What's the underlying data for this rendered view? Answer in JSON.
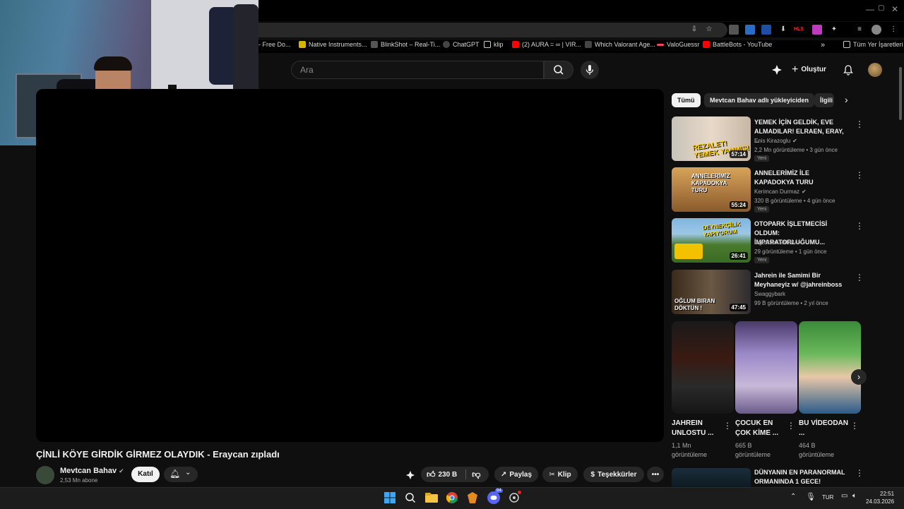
{
  "browser": {
    "bookmarks": [
      {
        "label": "- Free Do...",
        "color": "#000000"
      },
      {
        "label": "Native Instruments...",
        "color": "#d9b200"
      },
      {
        "label": "BlinkShot – Real-Ti...",
        "color": "#555555"
      },
      {
        "label": "ChatGPT",
        "color": "#444444"
      },
      {
        "label": "klip",
        "color": "#000000"
      },
      {
        "label": "(2) AURA = ∞ | VIR...",
        "color": "#ff0000"
      },
      {
        "label": "Which Valorant Age...",
        "color": "#444444"
      },
      {
        "label": "ValoGuessr",
        "color": "#ff4655"
      },
      {
        "label": "BattleBots - YouTube",
        "color": "#ff0000"
      }
    ],
    "all_bookmarks": "Tüm Yer İşaretleri",
    "more_bookmarks": "»"
  },
  "youtube": {
    "search_placeholder": "Ara",
    "create_label": "Oluştur",
    "video": {
      "title": "ÇİNLİ KÖYE GİRDİK GİRMEZ OLAYDIK - Eraycan zıpladı",
      "channel": "Mevtcan Bahav",
      "subscribers": "2,53 Mn abone",
      "join": "Katıl",
      "likes": "230 B",
      "share": "Paylaş",
      "clip": "Klip",
      "thanks": "Teşekkürler"
    },
    "chips": [
      "Tümü",
      "Mevtcan Bahav adlı yükleyiciden",
      "İlgili"
    ],
    "recommendations": [
      {
        "title": "YEMEK İÇİN GELDİK, EVE ALMADILAR! ELRAEN, ERAY, ...",
        "channel": "Enis Kirazoglu",
        "verified": true,
        "meta": "2,2 Mn görüntüleme • 3 gün önce",
        "badge": "Yeni",
        "duration": "57:14",
        "thumb_text": "REZALET! YEMEK YANMIŞ!"
      },
      {
        "title": "ANNELERİMİZ İLE KAPADOKYA TURU",
        "channel": "Kerimcan Durmaz",
        "verified": true,
        "meta": "320 B görüntüleme • 4 gün önce",
        "badge": "Yeni",
        "duration": "55:24",
        "thumb_text": "ANNELERİMİZ KAPADOKYA TURU"
      },
      {
        "title": "OTOPARK İŞLETMECİSİ OLDUM: İMPARATORLUĞUMU...",
        "channel": "Oğuzhan SALMAN",
        "verified": false,
        "meta": "29 görüntüleme • 1 gün önce",
        "badge": "Yeni",
        "duration": "26:41",
        "thumb_text": "DEYNEKÇİLİK YAPIYORUM"
      },
      {
        "title": "Jahrein ile Samimi Bir Meyhaneyiz w/ @jahreinboss",
        "channel": "Swaggybark",
        "verified": false,
        "meta": "99 B görüntüleme • 2 yıl önce",
        "badge": "",
        "duration": "47:45",
        "thumb_text": "OĞLUM BIRAN DÖKTÜN !"
      }
    ],
    "shorts": [
      {
        "title": "JAHREIN UNLOSTU ...",
        "views_line1": "1,1 Mn",
        "views_line2": "görüntüleme"
      },
      {
        "title": "ÇOCUK EN ÇOK KİME ...",
        "views_line1": "665 B",
        "views_line2": "görüntüleme"
      },
      {
        "title": "BU VİDEODAN ...",
        "views_line1": "464 B",
        "views_line2": "görüntüleme"
      }
    ],
    "next_rec": {
      "title": "DÜNYANIN EN PARANORMAL ORMANINDA 1 GECE!"
    }
  },
  "taskbar": {
    "language": "TUR",
    "time": "22:51",
    "date": "24.03.2026",
    "discord_badge": "94"
  },
  "colors": {
    "background": "#0f0f0f",
    "accent_red": "#ff0000"
  }
}
